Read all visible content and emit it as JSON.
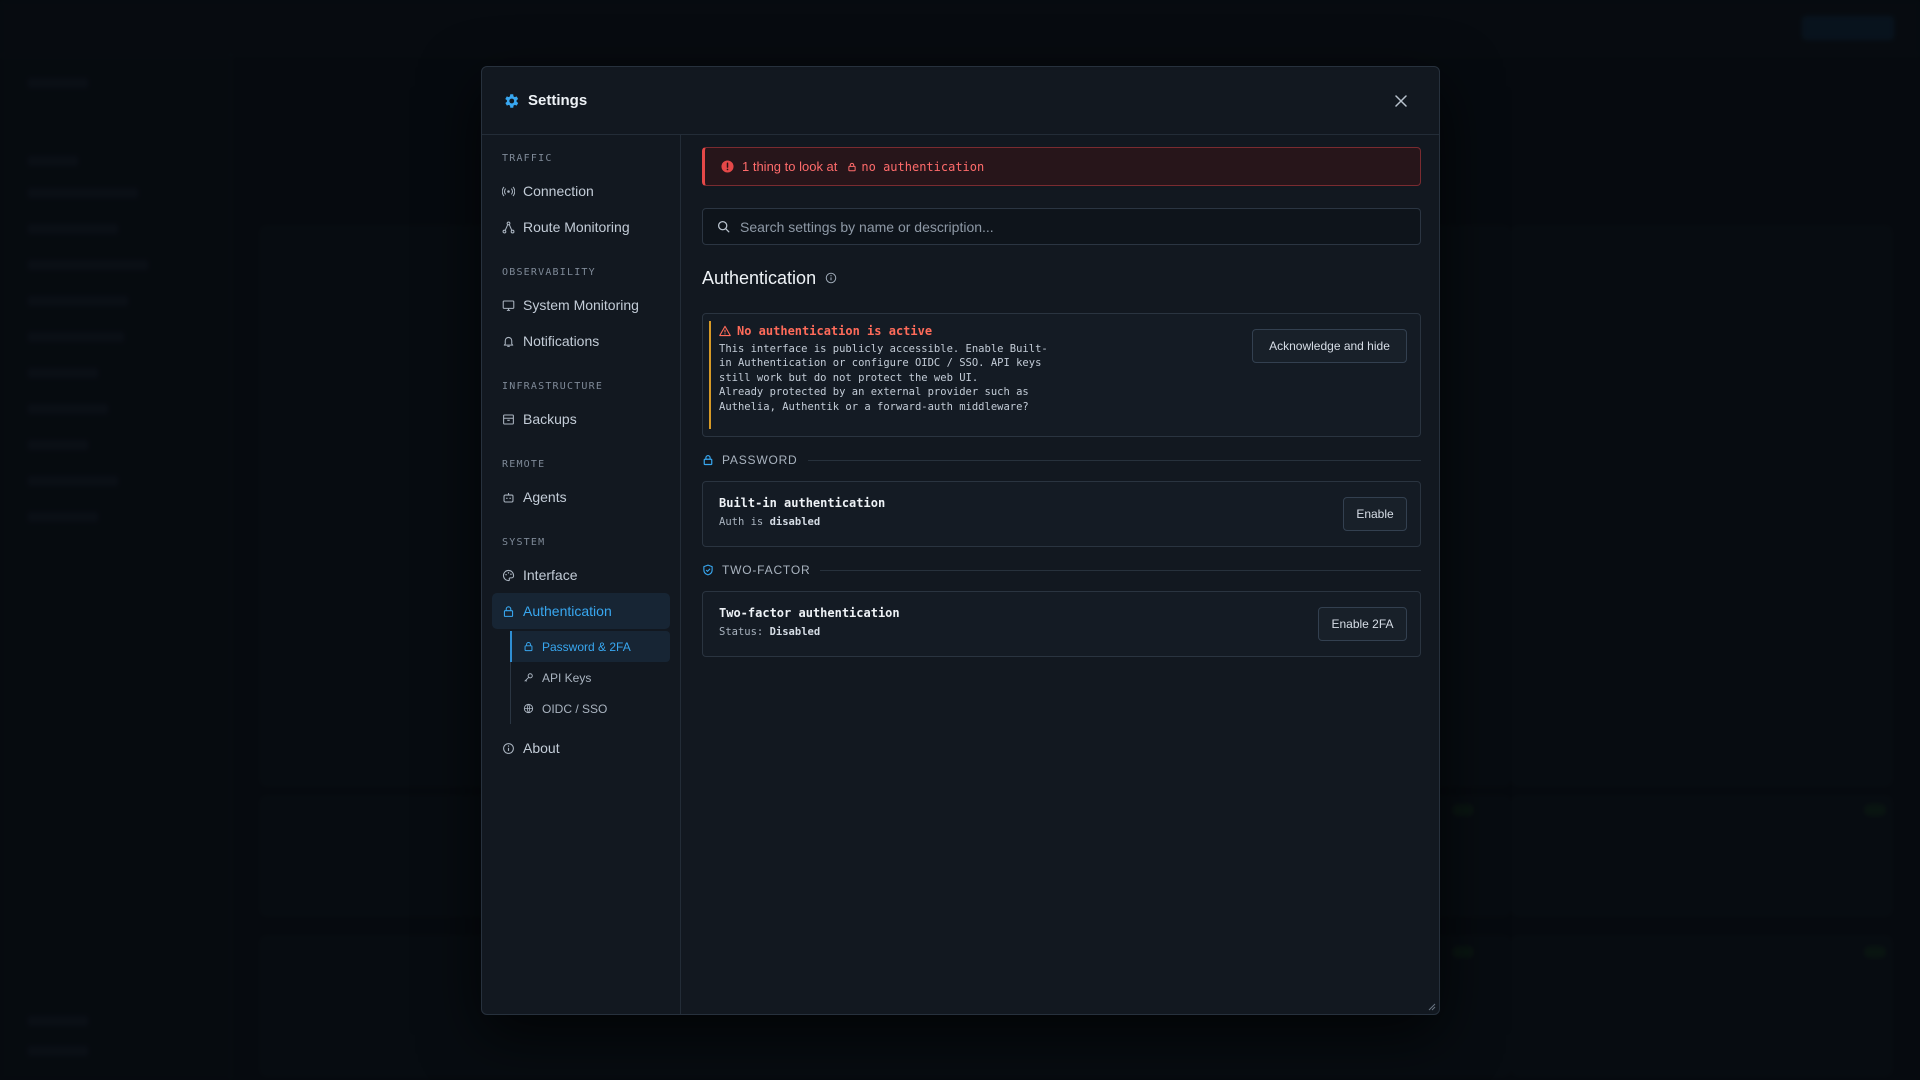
{
  "modal": {
    "title": "Settings",
    "accent": "#38a7f0"
  },
  "nav": {
    "groups": [
      {
        "label": "TRAFFIC",
        "items": [
          {
            "label": "Connection",
            "icon": "broadcast-icon"
          },
          {
            "label": "Route Monitoring",
            "icon": "route-icon"
          }
        ]
      },
      {
        "label": "OBSERVABILITY",
        "items": [
          {
            "label": "System Monitoring",
            "icon": "monitor-icon"
          },
          {
            "label": "Notifications",
            "icon": "bell-icon"
          }
        ]
      },
      {
        "label": "INFRASTRUCTURE",
        "items": [
          {
            "label": "Backups",
            "icon": "archive-icon"
          }
        ]
      },
      {
        "label": "REMOTE",
        "items": [
          {
            "label": "Agents",
            "icon": "agent-icon"
          }
        ]
      },
      {
        "label": "SYSTEM",
        "items": [
          {
            "label": "Interface",
            "icon": "palette-icon"
          },
          {
            "label": "Authentication",
            "icon": "lock-icon",
            "active": true
          }
        ]
      }
    ],
    "sub_items": [
      {
        "label": "Password & 2FA",
        "icon": "lock-icon",
        "active": true
      },
      {
        "label": "API Keys",
        "icon": "key-icon"
      },
      {
        "label": "OIDC / SSO",
        "icon": "globe-icon"
      }
    ],
    "about": {
      "label": "About",
      "icon": "info-icon"
    }
  },
  "alert": {
    "text": "1 thing to look at",
    "chip": "no authentication",
    "color": "#e54848"
  },
  "search": {
    "placeholder": "Search settings by name or description..."
  },
  "section": {
    "title": "Authentication"
  },
  "warning": {
    "title": "No authentication is active",
    "body_line1": "This interface is publicly accessible. Enable Built-",
    "body_line2": "in Authentication or configure OIDC / SSO. API keys",
    "body_line3": "still work but do not protect the web UI.",
    "body_line4": "Already protected by an external provider such as",
    "body_line5": "Authelia, Authentik or a forward-auth middleware?",
    "button": "Acknowledge and hide"
  },
  "password": {
    "group_label": "PASSWORD",
    "name": "Built-in authentication",
    "status_prefix": "Auth is",
    "status_value": "disabled",
    "button": "Enable"
  },
  "two_factor": {
    "group_label": "TWO-FACTOR",
    "name": "Two-factor authentication",
    "status_prefix": "Status:",
    "status_value": "Disabled",
    "button": "Enable 2FA"
  }
}
